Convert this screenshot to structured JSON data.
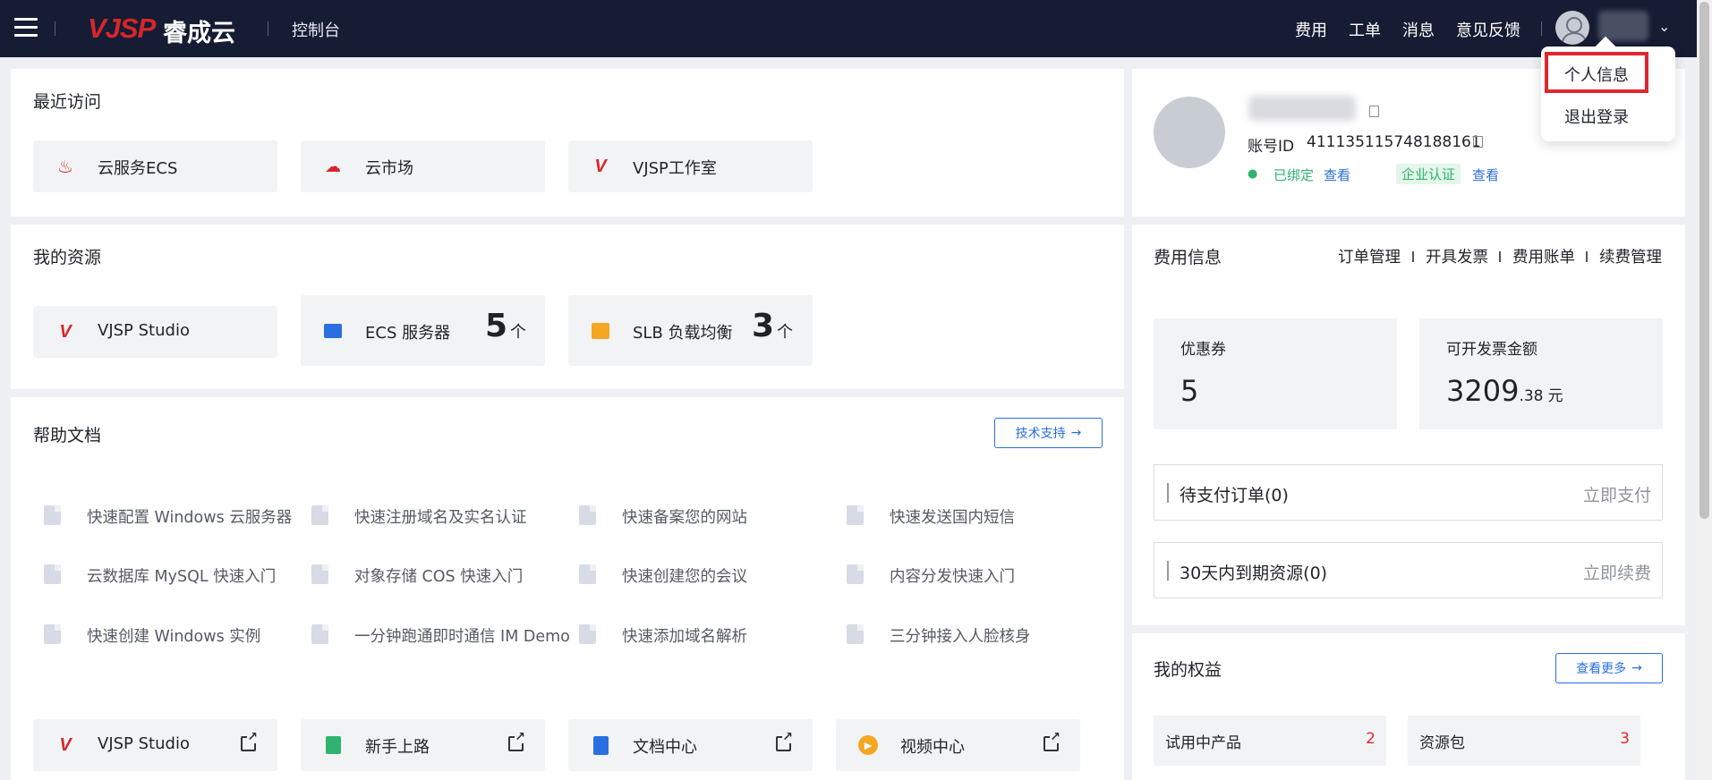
{
  "topbar": {
    "logo_text": "VJSP",
    "logo_cn": "睿成云",
    "console": "控制台",
    "nav": [
      "费用",
      "工单",
      "消息",
      "意见反馈"
    ]
  },
  "dropdown": {
    "items": [
      "个人信息",
      "退出登录"
    ]
  },
  "recent": {
    "title": "最近访问",
    "items": [
      "云服务ECS",
      "云市场",
      "VJSP工作室"
    ]
  },
  "resources": {
    "title": "我的资源",
    "items": [
      {
        "label": "VJSP Studio"
      },
      {
        "label": "ECS 服务器",
        "count": "5",
        "unit": "个"
      },
      {
        "label": "SLB 负载均衡",
        "count": "3",
        "unit": "个"
      }
    ]
  },
  "help": {
    "title": "帮助文档",
    "support_button": "技术支持",
    "docs": [
      [
        "快速配置 Windows 云服务器",
        "快速注册域名及实名认证",
        "快速备案您的网站",
        "快速发送国内短信"
      ],
      [
        "云数据库 MySQL 快速入门",
        "对象存储 COS 快速入门",
        "快速创建您的会议",
        "内容分发快速入门"
      ],
      [
        "快速创建 Windows 实例",
        "一分钟跑通即时通信 IM Demo",
        "快速添加域名解析",
        "三分钟接入人脸核身"
      ]
    ],
    "quick_links": [
      "VJSP Studio",
      "新手上路",
      "文档中心",
      "视频中心"
    ]
  },
  "account": {
    "id_label": "账号ID",
    "id_value": "411135115748188161",
    "wechat_status": "已绑定",
    "view1": "查看",
    "enterprise": "企业认证",
    "view2": "查看"
  },
  "fees": {
    "title": "费用信息",
    "links": [
      "订单管理",
      "开具发票",
      "费用账单",
      "续费管理"
    ],
    "coupon_label": "优惠券",
    "coupon_value": "5",
    "invoice_label": "可开发票金额",
    "invoice_int": "3209",
    "invoice_dec": ".38",
    "invoice_unit": "元",
    "pending_label": "待支付订单(0)",
    "pending_action": "立即支付",
    "expiring_label": "30天内到期资源(0)",
    "expiring_action": "立即续费"
  },
  "benefits": {
    "title": "我的权益",
    "more_button": "查看更多",
    "items": [
      {
        "label": "试用中产品",
        "count": "2"
      },
      {
        "label": "资源包",
        "count": "3"
      }
    ]
  },
  "colors": {
    "topbar": "#151c33",
    "brand_red": "#d6262c",
    "link_blue": "#2a6fe0",
    "highlight": "#e0262e"
  }
}
